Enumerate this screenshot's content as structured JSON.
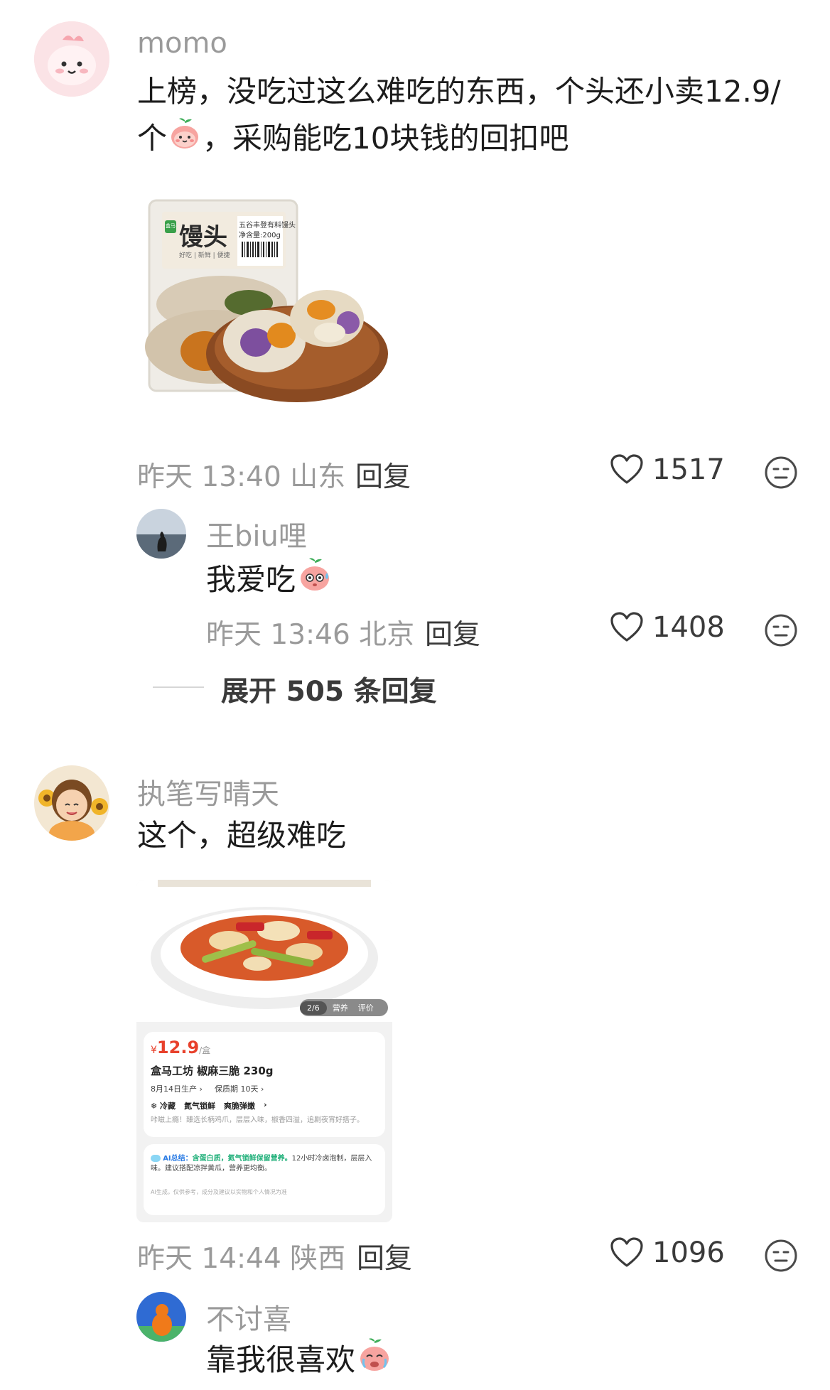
{
  "comments": [
    {
      "user": "momo",
      "text_line1": "上榜，没吃过这么难吃的东西，个头还小卖12.9/",
      "text_line2_a": "个",
      "text_line2_b": "，采购能吃10块钱的回扣吧",
      "time": "昨天 13:40 山东",
      "reply_label": "回复",
      "likes": "1517",
      "product_image": {
        "brand": "盒马",
        "title": "馒头",
        "tags": "好吃 | 新鲜 | 便捷",
        "sub": "五谷丰登有料馒头",
        "weight": "净含量:200g"
      },
      "sub_reply": {
        "user": "王biu哩",
        "text": "我爱吃",
        "time": "昨天 13:46 北京",
        "reply_label": "回复",
        "likes": "1408"
      },
      "expand_label": "展开 505 条回复"
    },
    {
      "user": "执笔写晴天",
      "text": "这个，超级难吃",
      "time": "昨天 14:44 陕西",
      "reply_label": "回复",
      "likes": "1096",
      "product_card": {
        "pager": "2/6",
        "tab1": "营养",
        "tab2": "评价",
        "currency": "¥",
        "price": "12.9",
        "unit": "/盒",
        "name": "盒马工坊 椒麻三脆 230g",
        "produced": "8月14日生产 ›",
        "shelf": "保质期 10天 ›",
        "feat1": "❄ 冷藏",
        "feat2": "氮气锁鲜",
        "feat3": "爽脆弹嫩",
        "feat_arrow": "›",
        "desc": "咔嗞上瘾！臻选长柄鸡爪，层层入味，椒香四溢，追剧夜宵好搭子。",
        "ai_label": "AI总结：",
        "ai_highlight": "含蛋白质，氮气锁鲜保留营养。",
        "ai_text_a": "12小时冷卤泡",
        "ai_text_b": "制，层层入味。建议搭配凉拌黄瓜，营养更均衡。",
        "ai_note": "AI生成，仅供参考，成分及建议以实物和个人情况为准"
      },
      "sub_reply": {
        "user": "不讨喜",
        "text": "靠我很喜欢"
      }
    }
  ],
  "colors": {
    "muted": "#9a9a9a",
    "text": "#1c1c1c",
    "price_red": "#e8412c",
    "ai_green": "#21b07a",
    "ai_blue": "#2a7be4"
  },
  "icons": [
    "heart-icon",
    "dislike-face-icon",
    "peach-emoji-icon",
    "avatar"
  ]
}
